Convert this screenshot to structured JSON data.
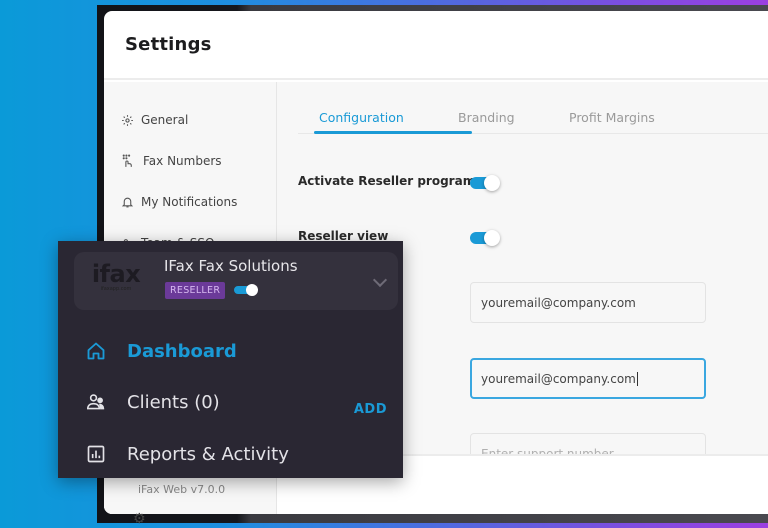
{
  "settings": {
    "title": "Settings",
    "nav": [
      {
        "label": "General",
        "icon": "gear-icon"
      },
      {
        "label": "Fax Numbers",
        "icon": "keypad-hand-icon"
      },
      {
        "label": "My Notifications",
        "icon": "bell-icon"
      },
      {
        "label": "Team & SSO",
        "icon": "team-icon"
      }
    ],
    "version": "iFax Web v7.0.0",
    "tabs": [
      {
        "label": "Configuration",
        "active": true
      },
      {
        "label": "Branding",
        "active": false
      },
      {
        "label": "Profit Margins",
        "active": false
      }
    ],
    "toggles": [
      {
        "label": "Activate Reseller program",
        "on": true
      },
      {
        "label": "Reseller view",
        "on": true
      }
    ],
    "fields": [
      {
        "value": "youremail@company.com",
        "placeholder": "",
        "focused": false
      },
      {
        "value": "youremail@company.com",
        "placeholder": "",
        "focused": true
      },
      {
        "value": "",
        "placeholder": "Enter support number",
        "focused": false
      }
    ]
  },
  "account_panel": {
    "logo_text": "ifax",
    "logo_subtext": "ifaxapp.com",
    "account_name": "IFax Fax Solutions",
    "badge": "RESELLER",
    "reseller_toggle_on": true,
    "menu": [
      {
        "label": "Dashboard",
        "icon": "home-icon",
        "active": true
      },
      {
        "label": "Clients (0)",
        "icon": "users-icon",
        "active": false,
        "action": "ADD"
      },
      {
        "label": "Reports & Activity",
        "icon": "chart-icon",
        "active": false
      }
    ]
  },
  "colors": {
    "accent": "#1a9ad6",
    "badge_bg": "#6b3a99",
    "panel_bg": "#2a2733"
  }
}
